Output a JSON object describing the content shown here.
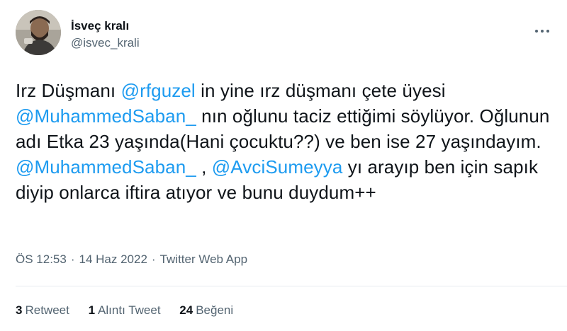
{
  "user": {
    "display_name": "İsveç kralı",
    "handle": "@isvec_krali",
    "avatar_icon": "profile-photo"
  },
  "more_icon": "more-dots-icon",
  "tweet": {
    "segments": [
      {
        "text": "Irz Düşmanı ",
        "type": "text"
      },
      {
        "text": "@rfguzel",
        "type": "mention"
      },
      {
        "text": " in yine ırz düşmanı çete üyesi ",
        "type": "text"
      },
      {
        "text": "@MuhammedSaban_",
        "type": "mention"
      },
      {
        "text": " nın oğlunu taciz ettiğimi söylüyor. Oğlunun adı Etka 23 yaşında(Hani çocuktu??) ve ben ise 27 yaşındayım.",
        "type": "text"
      },
      {
        "text": "@MuhammedSaban_",
        "type": "mention"
      },
      {
        "text": " , ",
        "type": "text"
      },
      {
        "text": "@AvciSumeyya",
        "type": "mention"
      },
      {
        "text": " yı arayıp ben için sapık diyip onlarca iftira atıyor ve bunu duydum++",
        "type": "text"
      }
    ]
  },
  "meta": {
    "time": "ÖS 12:53",
    "date": "14 Haz 2022",
    "source": "Twitter Web App",
    "separator": "·"
  },
  "stats": {
    "retweets_count": "3",
    "retweets_label": "Retweet",
    "quotes_count": "1",
    "quotes_label": "Alıntı Tweet",
    "likes_count": "24",
    "likes_label": "Beğeni"
  },
  "colors": {
    "mention": "#1d9bf0",
    "secondary_text": "#536471",
    "primary_text": "#0f1419"
  }
}
